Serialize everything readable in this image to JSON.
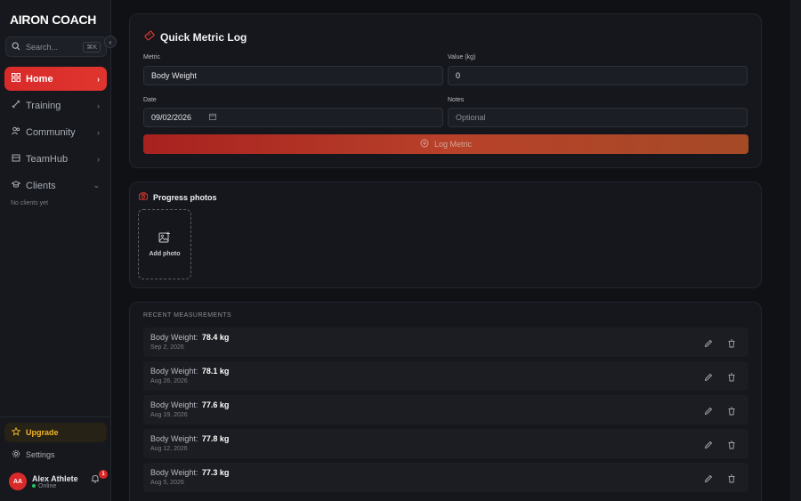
{
  "sidebar": {
    "logo": "AIRON COACH",
    "search": {
      "placeholder": "Search...",
      "shortcut": "⌘K"
    },
    "items": [
      {
        "label": "Home"
      },
      {
        "label": "Training"
      },
      {
        "label": "Community"
      },
      {
        "label": "TeamHub"
      },
      {
        "label": "Clients"
      }
    ],
    "no_clients": "No clients yet",
    "upgrade": "Upgrade",
    "settings": "Settings",
    "user": {
      "initials": "AA",
      "name": "Alex Athlete",
      "status": "Online",
      "notifications": "1"
    }
  },
  "metric_log": {
    "title": "Quick Metric Log",
    "metric_label": "Metric",
    "metric_value": "Body Weight",
    "value_label": "Value (kg)",
    "value_value": "0",
    "date_label": "Date",
    "date_value": "09/02/2026",
    "notes_label": "Notes",
    "notes_placeholder": "Optional",
    "log_button": "Log Metric"
  },
  "photos": {
    "title": "Progress photos",
    "add_label": "Add photo"
  },
  "recent": {
    "title": "RECENT MEASUREMENTS",
    "rows": [
      {
        "label": "Body Weight:",
        "value": "78.4 kg",
        "date": "Sep 2, 2026"
      },
      {
        "label": "Body Weight:",
        "value": "78.1 kg",
        "date": "Aug 26, 2026"
      },
      {
        "label": "Body Weight:",
        "value": "77.6 kg",
        "date": "Aug 19, 2026"
      },
      {
        "label": "Body Weight:",
        "value": "77.8 kg",
        "date": "Aug 12, 2026"
      },
      {
        "label": "Body Weight:",
        "value": "77.3 kg",
        "date": "Aug 5, 2026"
      }
    ]
  },
  "colors": {
    "accent": "#d92a2a",
    "upgrade": "#f0b429",
    "online": "#22c55e"
  }
}
